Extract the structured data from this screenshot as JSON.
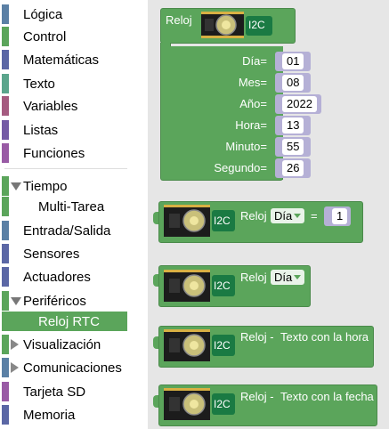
{
  "toolbox": {
    "categories": [
      {
        "label": "Lógica",
        "color": "#5b80a5"
      },
      {
        "label": "Control",
        "color": "#5ba55b"
      },
      {
        "label": "Matemáticas",
        "color": "#5b67a5"
      },
      {
        "label": "Texto",
        "color": "#5ba58c"
      },
      {
        "label": "Variables",
        "color": "#a55b80"
      },
      {
        "label": "Listas",
        "color": "#745ba5"
      },
      {
        "label": "Funciones",
        "color": "#995ba5"
      },
      {
        "label": "Tiempo",
        "color": "#5ba55b"
      },
      {
        "label": "Multi-Tarea",
        "color": "#5ba55b"
      },
      {
        "label": "Entrada/Salida",
        "color": "#5b80a5"
      },
      {
        "label": "Sensores",
        "color": "#5b67a5"
      },
      {
        "label": "Actuadores",
        "color": "#5b67a5"
      },
      {
        "label": "Periféricos",
        "color": "#5ba55b"
      },
      {
        "label": "Reloj RTC",
        "color": "#5ba55b"
      },
      {
        "label": "Visualización",
        "color": "#5ba55b"
      },
      {
        "label": "Comunicaciones",
        "color": "#5b80a5"
      },
      {
        "label": "Tarjeta SD",
        "color": "#995ba5"
      },
      {
        "label": "Memoria",
        "color": "#5b67a5"
      }
    ]
  },
  "blocks": {
    "set_clock": {
      "title": "Reloj",
      "module_label": "I2C",
      "fields": [
        {
          "label": "Día=",
          "value": "01"
        },
        {
          "label": "Mes=",
          "value": "08"
        },
        {
          "label": "Año=",
          "value": "2022"
        },
        {
          "label": "Hora=",
          "value": "13"
        },
        {
          "label": "Minuto=",
          "value": "55"
        },
        {
          "label": "Segundo=",
          "value": "26"
        }
      ]
    },
    "compare": {
      "title": "Reloj",
      "dropdown": "Día",
      "operator": "=",
      "value": "1",
      "module_label": "I2C"
    },
    "get": {
      "title": "Reloj",
      "dropdown": "Día",
      "module_label": "I2C"
    },
    "time_text": {
      "title": "Reloj -",
      "text": "Texto con la hora",
      "module_label": "I2C"
    },
    "date_text": {
      "title": "Reloj -",
      "text": "Texto con la fecha",
      "module_label": "I2C"
    }
  },
  "colors": {
    "block": "#5ba55b",
    "workspace": "#e6e6e6",
    "slot": "#b5b0d6",
    "module_blue": "#2a68b6"
  }
}
